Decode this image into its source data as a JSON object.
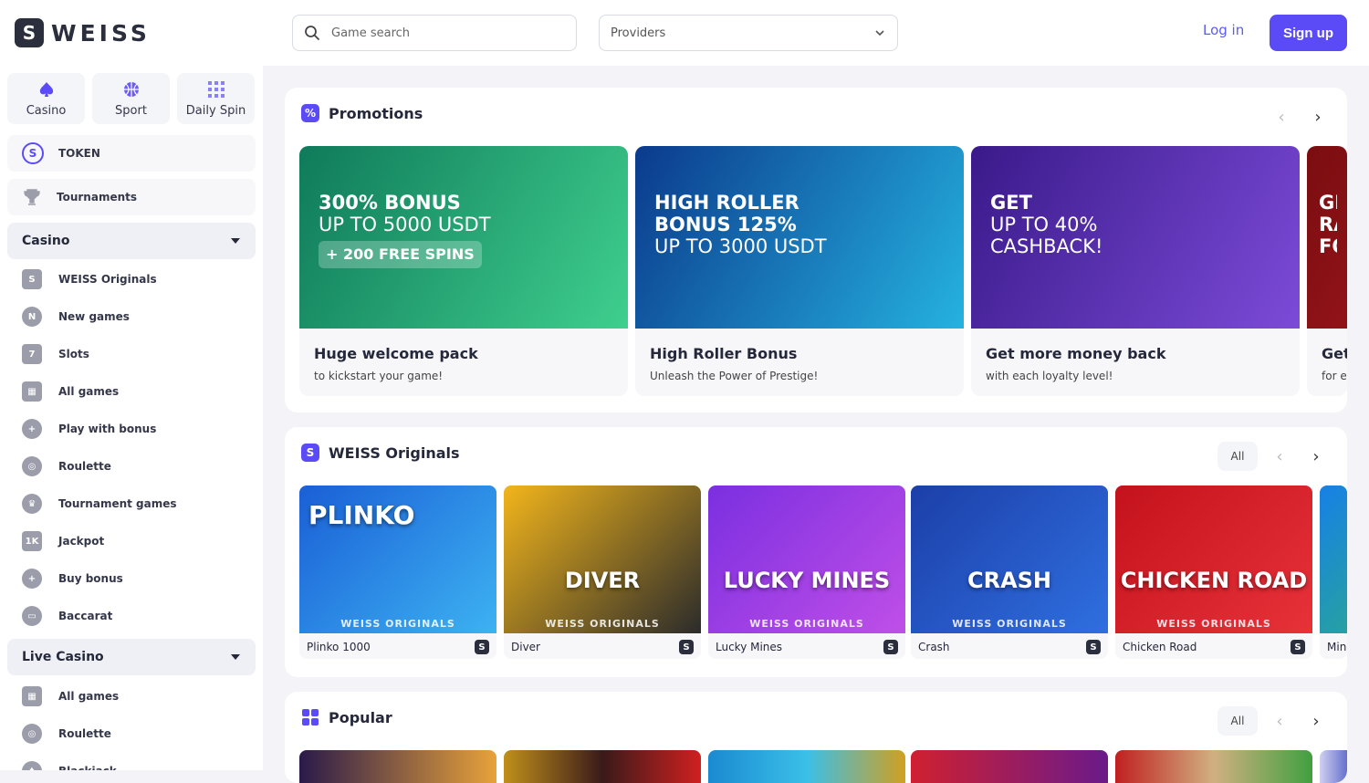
{
  "header": {
    "logo_mark": "S",
    "logo_text": "WEISS",
    "search_placeholder": "Game search",
    "providers_label": "Providers",
    "login_label": "Log in",
    "signup_label": "Sign up"
  },
  "sidebar": {
    "quick": [
      {
        "label": "Casino",
        "icon": "spade-icon"
      },
      {
        "label": "Sport",
        "icon": "basketball-icon"
      },
      {
        "label": "Daily Spin",
        "icon": "grid-dots-icon"
      }
    ],
    "token_label": "TOKEN",
    "tournaments_label": "Tournaments",
    "casino_group": "Casino",
    "casino_items": [
      {
        "label": "WEISS Originals",
        "icon": "weiss-icon"
      },
      {
        "label": "New games",
        "icon": "new-badge-icon"
      },
      {
        "label": "Slots",
        "icon": "slots-icon"
      },
      {
        "label": "All games",
        "icon": "grid-icon"
      },
      {
        "label": "Play with bonus",
        "icon": "bonus-play-icon"
      },
      {
        "label": "Roulette",
        "icon": "roulette-icon"
      },
      {
        "label": "Tournament games",
        "icon": "trophy-icon"
      },
      {
        "label": "Jackpot",
        "icon": "jackpot-icon"
      },
      {
        "label": "Buy bonus",
        "icon": "plus-circle-icon"
      },
      {
        "label": "Baccarat",
        "icon": "baccarat-icon"
      }
    ],
    "live_group": "Live Casino",
    "live_items": [
      {
        "label": "All games",
        "icon": "grid-icon"
      },
      {
        "label": "Roulette",
        "icon": "roulette-icon"
      },
      {
        "label": "Blackjack",
        "icon": "cards-icon"
      }
    ]
  },
  "promotions": {
    "title": "Promotions",
    "cards": [
      {
        "headline_bold": "300% BONUS",
        "headline_thin": "UP TO 5000 USDT",
        "extra": "+ 200 FREE SPINS",
        "title": "Huge welcome pack",
        "subtitle": "to kickstart your game!",
        "color1": "#0f7a5a",
        "color2": "#3fcf8e"
      },
      {
        "headline_bold": "HIGH ROLLER BONUS 125%",
        "headline_thin": "UP TO 3000 USDT",
        "extra": "",
        "title": "High Roller Bonus",
        "subtitle": "Unleash the Power of Prestige!",
        "color1": "#0b3a8c",
        "color2": "#25b2e0"
      },
      {
        "headline_bold": "GET",
        "headline_thin": "UP TO 40% CASHBACK!",
        "extra": "",
        "title": "Get more money back",
        "subtitle": "with each loyalty level!",
        "color1": "#3a1a8a",
        "color2": "#7c4bd8"
      },
      {
        "headline_bold": "GE RA FO",
        "headline_thin": "",
        "extra": "",
        "title": "Get",
        "subtitle": "for e",
        "color1": "#7a0d10",
        "color2": "#c0202a"
      }
    ]
  },
  "originals": {
    "title": "WEISS Originals",
    "all_label": "All",
    "games": [
      {
        "name": "Plinko 1000",
        "art": "PLINKO",
        "footer": "WEISS ORIGINALS",
        "color1": "#1a5fd6",
        "color2": "#3db2f2"
      },
      {
        "name": "Diver",
        "art": "DIVER",
        "footer": "WEISS ORIGINALS",
        "color1": "#f2b51b",
        "color2": "#2b2b2b"
      },
      {
        "name": "Lucky Mines",
        "art": "LUCKY MINES",
        "footer": "WEISS ORIGINALS",
        "color1": "#7b2fe0",
        "color2": "#c04fe8"
      },
      {
        "name": "Crash",
        "art": "CRASH",
        "footer": "WEISS ORIGINALS",
        "color1": "#1c3fa8",
        "color2": "#2f6fe0"
      },
      {
        "name": "Chicken Road",
        "art": "CHICKEN ROAD",
        "footer": "WEISS ORIGINALS",
        "color1": "#c4121c",
        "color2": "#e8323a"
      },
      {
        "name": "Mine",
        "art": "",
        "footer": "",
        "color1": "#1780e6",
        "color2": "#38c060"
      }
    ]
  },
  "popular": {
    "title": "Popular",
    "all_label": "All"
  },
  "badge_letter": "S",
  "accent": "#5b4bf7"
}
